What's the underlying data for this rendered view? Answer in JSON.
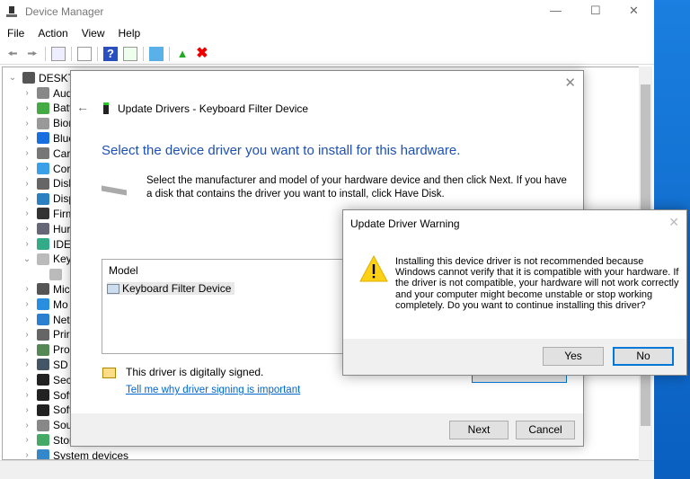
{
  "app": {
    "title": "Device Manager"
  },
  "menu": [
    "File",
    "Action",
    "View",
    "Help"
  ],
  "tree": {
    "root": "DESKTC",
    "items": [
      {
        "label": "Aud",
        "color": "#888"
      },
      {
        "label": "Batt",
        "color": "#4a4"
      },
      {
        "label": "Bior",
        "color": "#999"
      },
      {
        "label": "Blue",
        "color": "#1a6fe0"
      },
      {
        "label": "Car",
        "color": "#777"
      },
      {
        "label": "Cor",
        "color": "#3aa0e8"
      },
      {
        "label": "Disk",
        "color": "#666"
      },
      {
        "label": "Disp",
        "color": "#2a80c0"
      },
      {
        "label": "Firm",
        "color": "#333"
      },
      {
        "label": "Hur",
        "color": "#667"
      },
      {
        "label": "IDE",
        "color": "#3a8"
      },
      {
        "label": "Key",
        "color": "#bbb",
        "expanded": true
      },
      {
        "label": "",
        "color": "#bbb",
        "child": true
      },
      {
        "label": "Mic",
        "color": "#555"
      },
      {
        "label": "Mo",
        "color": "#2a8ee0"
      },
      {
        "label": "Net",
        "color": "#2a7fd0"
      },
      {
        "label": "Prir",
        "color": "#666"
      },
      {
        "label": "Pro",
        "color": "#585"
      },
      {
        "label": "SD I",
        "color": "#456"
      },
      {
        "label": "Sec",
        "color": "#222"
      },
      {
        "label": "Soft",
        "color": "#222"
      },
      {
        "label": "Soft",
        "color": "#222"
      },
      {
        "label": "Sou",
        "color": "#888"
      },
      {
        "label": "Stor",
        "color": "#4a6"
      },
      {
        "label": "System devices",
        "color": "#38c"
      }
    ]
  },
  "update_dialog": {
    "title": "Update Drivers - Keyboard Filter Device",
    "heading": "Select the device driver you want to install for this hardware.",
    "description": "Select the manufacturer and model of your hardware device and then click Next. If you have a disk that contains the driver you want to install, click Have Disk.",
    "model_header": "Model",
    "model_item": "Keyboard Filter Device",
    "signed_text": "This driver is digitally signed.",
    "signing_link": "Tell me why driver signing is important",
    "next": "Next",
    "cancel": "Cancel"
  },
  "warning_dialog": {
    "title": "Update Driver Warning",
    "message": "Installing this device driver is not recommended because Windows cannot verify that it is compatible with your hardware.  If the driver is not compatible, your hardware will not work correctly and your computer might become unstable or stop working completely.  Do you want to continue installing this driver?",
    "yes": "Yes",
    "no": "No"
  }
}
